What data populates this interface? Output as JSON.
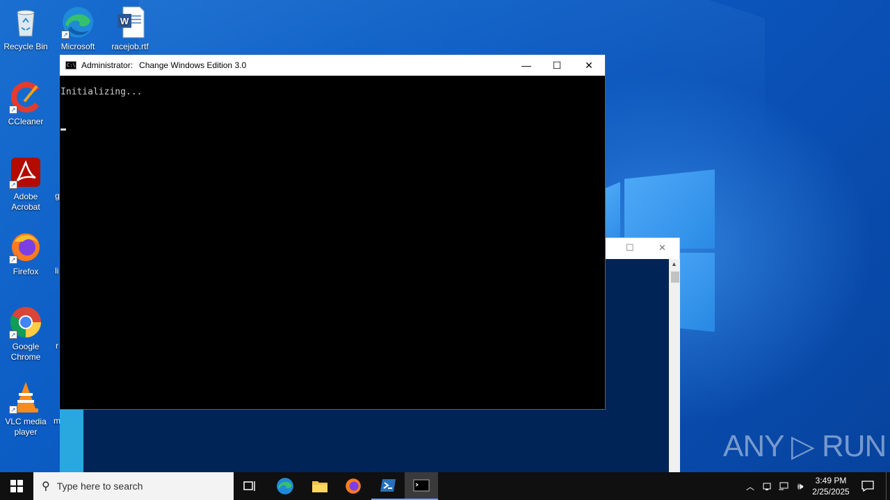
{
  "desktop": {
    "icons": [
      {
        "label": "Recycle Bin",
        "icon": "recycle-bin-icon"
      },
      {
        "label": "Microsoft Edge",
        "icon": "edge-icon"
      },
      {
        "label": "racejob.rtf",
        "icon": "word-document-icon"
      },
      {
        "label": "CCleaner",
        "icon": "ccleaner-icon"
      },
      {
        "label": "Adobe Acrobat",
        "icon": "acrobat-icon"
      },
      {
        "label": "Firefox",
        "icon": "firefox-icon"
      },
      {
        "label": "Google Chrome",
        "icon": "chrome-icon"
      },
      {
        "label": "VLC media player",
        "icon": "vlc-icon"
      }
    ],
    "partial_labels": [
      "g",
      "li",
      "r",
      "mightcl"
    ]
  },
  "console_window": {
    "title_prefix": "Administrator:",
    "title": "Change Windows Edition 3.0",
    "output_line": "Initializing...",
    "minimize": "—",
    "maximize": "☐",
    "close": "✕"
  },
  "background_window": {
    "maximize": "☐",
    "close": "✕"
  },
  "watermark": "ANY ▷ RUN",
  "taskbar": {
    "search_placeholder": "Type here to search",
    "time": "3:49 PM",
    "date": "2/25/2025",
    "apps": [
      "task-view",
      "edge",
      "file-explorer",
      "firefox",
      "powershell",
      "cmd"
    ]
  },
  "colors": {
    "console_bg": "#000000",
    "powershell_bg": "#012456",
    "taskbar_bg": "#101010"
  }
}
